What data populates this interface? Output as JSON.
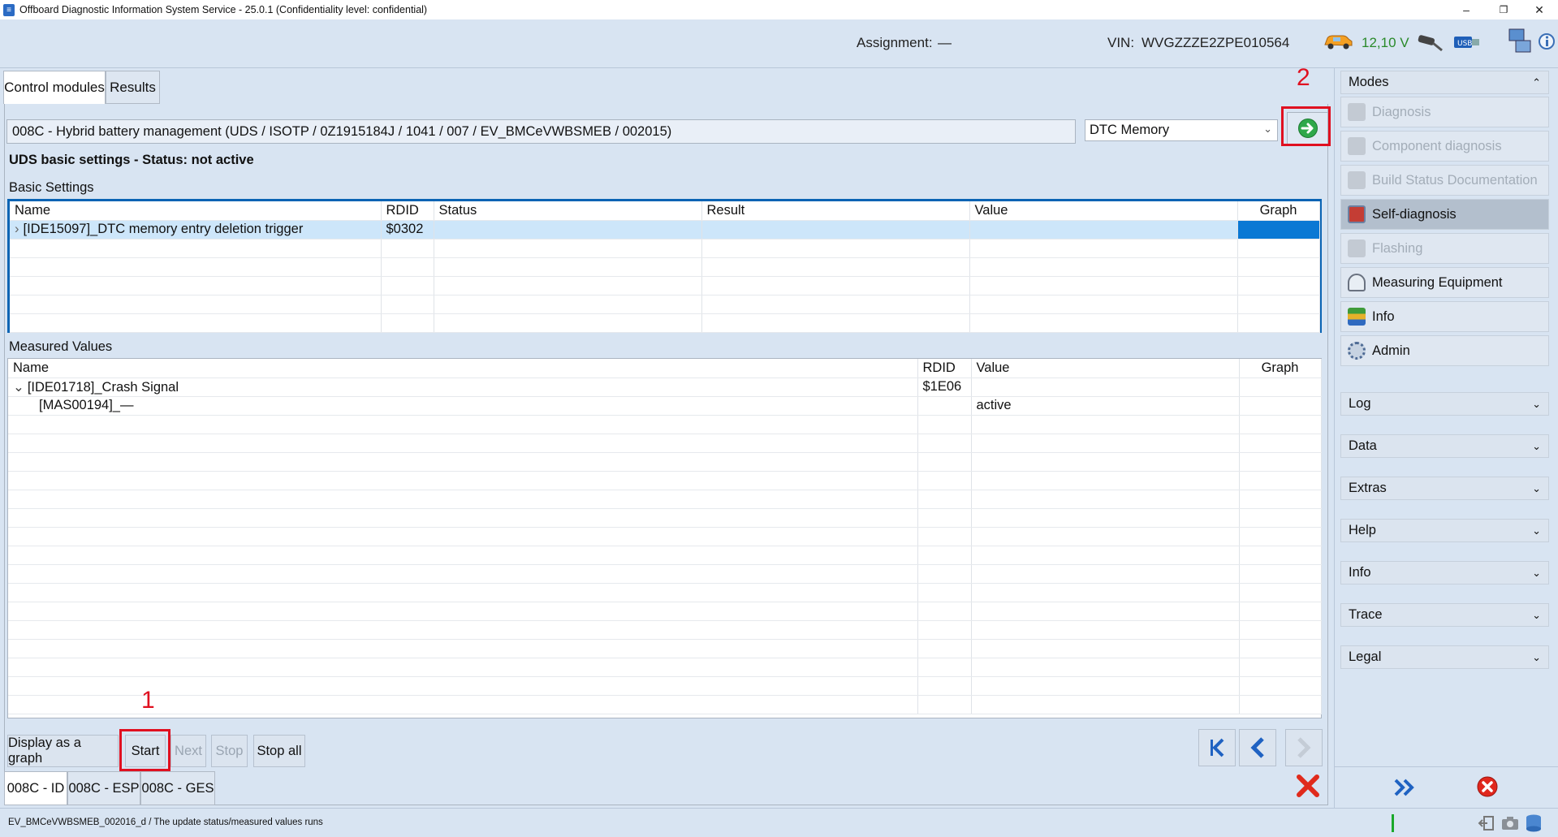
{
  "window": {
    "title": "Offboard Diagnostic Information System Service - 25.0.1 (Confidentiality level: confidential)",
    "minimize": "–",
    "restore": "❐",
    "close": "✕"
  },
  "header": {
    "assignment_label": "Assignment:",
    "assignment_value": "—",
    "vin_label": "VIN:",
    "vin_value": "WVGZZZE2ZPE010564",
    "voltage": "12,10 V"
  },
  "tabs": [
    {
      "label": "Control modules",
      "active": true
    },
    {
      "label": "Results",
      "active": false
    }
  ],
  "module": {
    "description": "008C - Hybrid battery management  (UDS / ISOTP / 0Z1915184J / 1041 / 007 / EV_BMCeVWBSMEB / 002015)",
    "function_select": "DTC Memory"
  },
  "annotations": {
    "marker_1": "1",
    "marker_2": "2"
  },
  "basic_settings": {
    "status_title": "UDS basic settings - Status: not active",
    "section_label": "Basic Settings",
    "columns": [
      "Name",
      "RDID",
      "Status",
      "Result",
      "Value",
      "Graph"
    ],
    "rows": [
      {
        "expander": "›",
        "name": "[IDE15097]_DTC memory entry deletion trigger",
        "rdid": "$0302",
        "status": "",
        "result": "",
        "value": "",
        "graph": ""
      }
    ]
  },
  "measured_values": {
    "section_label": "Measured Values",
    "columns": [
      "Name",
      "RDID",
      "Value",
      "Graph"
    ],
    "rows": [
      {
        "expander": "⌄",
        "name": "[IDE01718]_Crash Signal",
        "rdid": "$1E06",
        "value": "",
        "indent": 0
      },
      {
        "expander": "",
        "name": "[MAS00194]_—",
        "rdid": "",
        "value": "active",
        "indent": 1
      }
    ]
  },
  "actions": {
    "display_graph": "Display as a graph",
    "start": "Start",
    "next": "Next",
    "stop": "Stop",
    "stop_all": "Stop all"
  },
  "bottom_tabs": [
    "008C - ID",
    "008C - ESP",
    "008C - GES"
  ],
  "sidebar": {
    "modes_label": "Modes",
    "modes": [
      {
        "label": "Diagnosis",
        "enabled": false,
        "icon": "stethoscope-icon"
      },
      {
        "label": "Component diagnosis",
        "enabled": false,
        "icon": "car-icon"
      },
      {
        "label": "Build Status Documentation",
        "enabled": false,
        "icon": "document-icon"
      },
      {
        "label": "Self-diagnosis",
        "enabled": true,
        "active": true,
        "icon": "book-icon"
      },
      {
        "label": "Flashing",
        "enabled": false,
        "icon": "flash-icon"
      },
      {
        "label": "Measuring Equipment",
        "enabled": true,
        "icon": "gauge-icon"
      },
      {
        "label": "Info",
        "enabled": true,
        "icon": "books-icon"
      },
      {
        "label": "Admin",
        "enabled": true,
        "icon": "gear-icon"
      }
    ],
    "sections": [
      "Log",
      "Data",
      "Extras",
      "Help",
      "Info",
      "Trace",
      "Legal"
    ]
  },
  "statusbar": {
    "text": "EV_BMCeVWBSMEB_002016_d / The update status/measured values runs"
  },
  "colors": {
    "annotation_red": "#e01020",
    "selection_blue": "#0a78d4",
    "background": "#d8e4f2"
  }
}
